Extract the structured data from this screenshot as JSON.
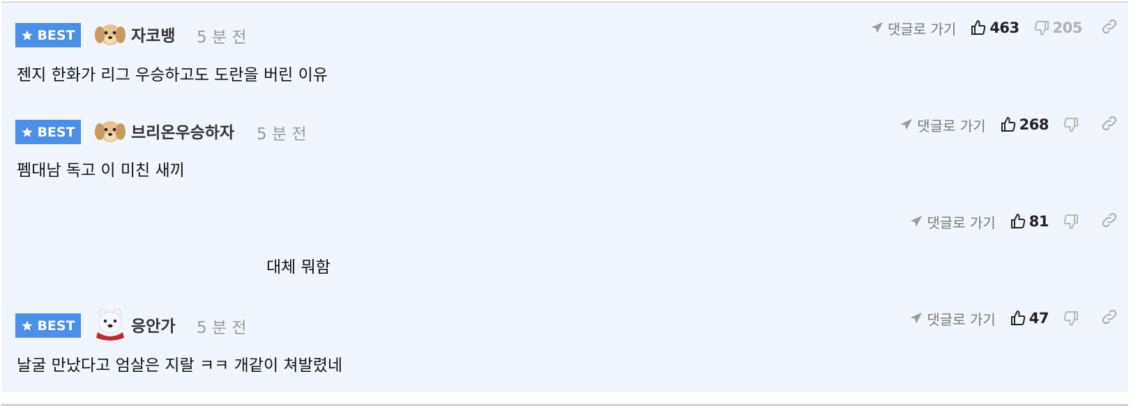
{
  "comments": [
    {
      "badge": "BEST",
      "nickname": "자코뱅",
      "time": "5 분 전",
      "text": "젠지 한화가 리그 우승하고도 도란을 버린 이유",
      "goto_label": "댓글로 가기",
      "likes": "463",
      "dislikes": "205",
      "avatar": "puppy-avatar"
    },
    {
      "badge": "BEST",
      "nickname": "브리온우승하자",
      "time": "5 분 전",
      "text": "펨대남 독고 이 미친 새끼",
      "goto_label": "댓글로 가기",
      "likes": "268",
      "dislikes": "",
      "avatar": "puppy-avatar"
    },
    {
      "text": "대체 뭐함",
      "goto_label": "댓글로 가기",
      "likes": "81",
      "dislikes": ""
    },
    {
      "badge": "BEST",
      "nickname": "응안가",
      "time": "5 분 전",
      "text": "날굴 만났다고 엄살은 지랄 ㅋㅋ 개같이 쳐발렸네",
      "goto_label": "댓글로 가기",
      "likes": "47",
      "dislikes": "",
      "avatar": "polar-bear-avatar"
    }
  ],
  "colors": {
    "best_badge": "#4a8fe8",
    "row_background": "#f1f6fe"
  }
}
